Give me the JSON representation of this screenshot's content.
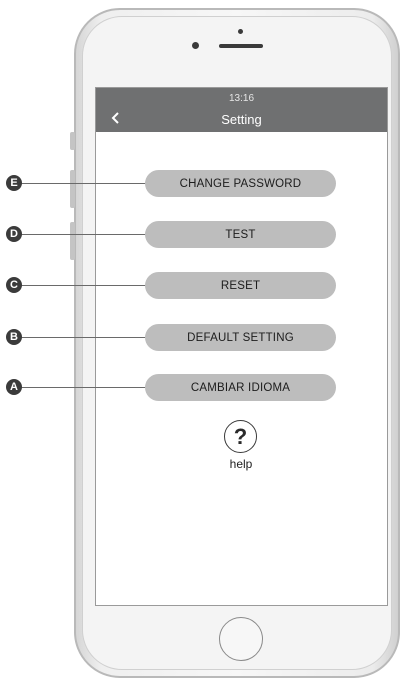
{
  "status_bar": {
    "time": "13:16"
  },
  "header": {
    "title": "Setting",
    "back_icon": "chevron-left-icon"
  },
  "menu": [
    {
      "callout": "E",
      "label": "CHANGE PASSWORD"
    },
    {
      "callout": "D",
      "label": "TEST"
    },
    {
      "callout": "C",
      "label": "RESET"
    },
    {
      "callout": "B",
      "label": "DEFAULT SETTING"
    },
    {
      "callout": "A",
      "label": "CAMBIAR IDIOMA"
    }
  ],
  "help": {
    "symbol": "?",
    "label": "help",
    "icon": "question-mark-icon"
  },
  "colors": {
    "status_bar": "#6f7071",
    "menu_button": "#bdbdbd",
    "callout_badge": "#3b3b3b"
  }
}
